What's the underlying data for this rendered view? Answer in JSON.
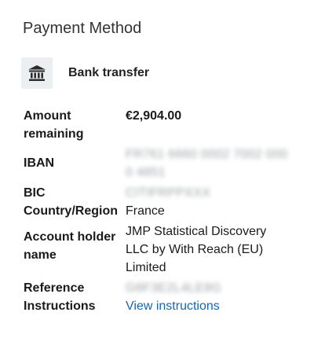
{
  "panel": {
    "title": "Payment Method",
    "method": {
      "icon": "bank-icon",
      "label": "Bank transfer"
    }
  },
  "details": {
    "amount": {
      "label": "Amount remaining",
      "value": "€2,904.00"
    },
    "iban": {
      "label": "IBAN",
      "value": "FR761 6660 0002 7002 0000 4851",
      "redacted": true
    },
    "bic": {
      "label": "BIC",
      "value": "CITIFRPPXXX",
      "redacted": true
    },
    "country": {
      "label": "Country/Region",
      "value": "France"
    },
    "holder": {
      "label": "Account holder name",
      "value": "JMP Statistical Discovery LLC by With Reach (EU) Limited"
    },
    "reference": {
      "label": "Reference",
      "value": "G8F3E2L4LE8G",
      "redacted": true
    },
    "instructions": {
      "label": "Instructions",
      "link_text": "View instructions"
    }
  },
  "colors": {
    "link": "#1565b6",
    "icon_bg": "#eceff2",
    "icon_fg": "#2b2b2b"
  }
}
